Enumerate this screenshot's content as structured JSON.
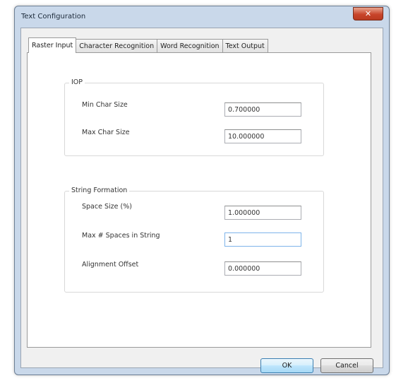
{
  "window": {
    "title": "Text Configuration"
  },
  "tabs": [
    "Raster Input",
    "Character Recognition",
    "Word Recognition",
    "Text Output"
  ],
  "groups": {
    "iop": {
      "title": "IOP",
      "min_char_size_label": "Min Char Size",
      "min_char_size_value": "0.700000",
      "max_char_size_label": "Max Char Size",
      "max_char_size_value": "10.000000"
    },
    "string_formation": {
      "title": "String Formation",
      "space_size_label": "Space Size (%)",
      "space_size_value": "1.000000",
      "max_spaces_label": "Max # Spaces in String",
      "max_spaces_value": "1",
      "alignment_offset_label": "Alignment Offset",
      "alignment_offset_value": "0.000000"
    }
  },
  "buttons": {
    "ok": "OK",
    "cancel": "Cancel"
  }
}
